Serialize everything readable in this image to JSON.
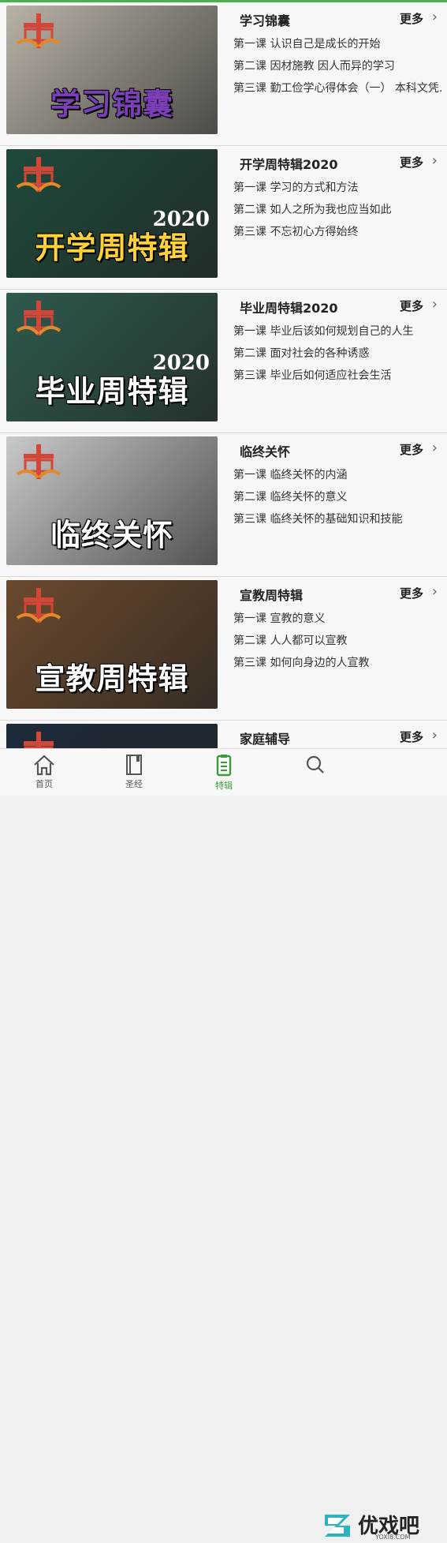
{
  "cards": [
    {
      "title": "学习锦囊",
      "more": "更多",
      "caption": "学习锦囊",
      "year": "",
      "lessons": [
        "第一课 认识自己是成长的开始",
        "第二课 因材施教 因人而异的学习",
        "第三课 勤工俭学心得体会（一） 本科文凭…"
      ],
      "bg": "#b9b2a6",
      "caption_color": "#7b3fb8"
    },
    {
      "title": "开学周特辑2020",
      "more": "更多",
      "caption": "开学周特辑",
      "year": "2020",
      "lessons": [
        "第一课 学习的方式和方法",
        "第二课 如人之所为我也应当如此",
        "第三课 不忘初心方得始终"
      ],
      "bg": "#1f4a3b",
      "caption_color": "#ffd23a"
    },
    {
      "title": "毕业周特辑2020",
      "more": "更多",
      "caption": "毕业周特辑",
      "year": "2020",
      "lessons": [
        "第一课 毕业后该如何规划自己的人生",
        "第二课 面对社会的各种诱惑",
        "第三课 毕业后如何适应社会生活"
      ],
      "bg": "#2e5a4d",
      "caption_color": "#ffffff"
    },
    {
      "title": "临终关怀",
      "more": "更多",
      "caption": "临终关怀",
      "year": "",
      "lessons": [
        "第一课 临终关怀的内涵",
        "第二课 临终关怀的意义",
        "第三课 临终关怀的基础知识和技能"
      ],
      "bg": "#c9c9c9",
      "caption_color": "#ffffff"
    },
    {
      "title": "宣教周特辑",
      "more": "更多",
      "caption": "宣教周特辑",
      "year": "",
      "lessons": [
        "第一课 宣教的意义",
        "第二课 人人都可以宣教",
        "第三课 如何向身边的人宣教"
      ],
      "bg": "#6b4a2e",
      "caption_color": "#ffffff"
    },
    {
      "title": "家庭辅导",
      "more": "更多",
      "caption": "",
      "year": "",
      "lessons": [],
      "bg": "#1d2b3a",
      "caption_color": "#ffffff"
    }
  ],
  "tabbar": [
    {
      "label": "首页",
      "icon": "home-icon",
      "active": false
    },
    {
      "label": "圣经",
      "icon": "book-icon",
      "active": false
    },
    {
      "label": "特辑",
      "icon": "document-list-icon",
      "active": true
    },
    {
      "label": "",
      "icon": "search-icon",
      "active": false
    }
  ],
  "watermark": {
    "text": "优戏吧",
    "sub": "YOXI8.COM"
  },
  "colors": {
    "accent": "#3a9b3a",
    "topline": "#4caf50"
  }
}
